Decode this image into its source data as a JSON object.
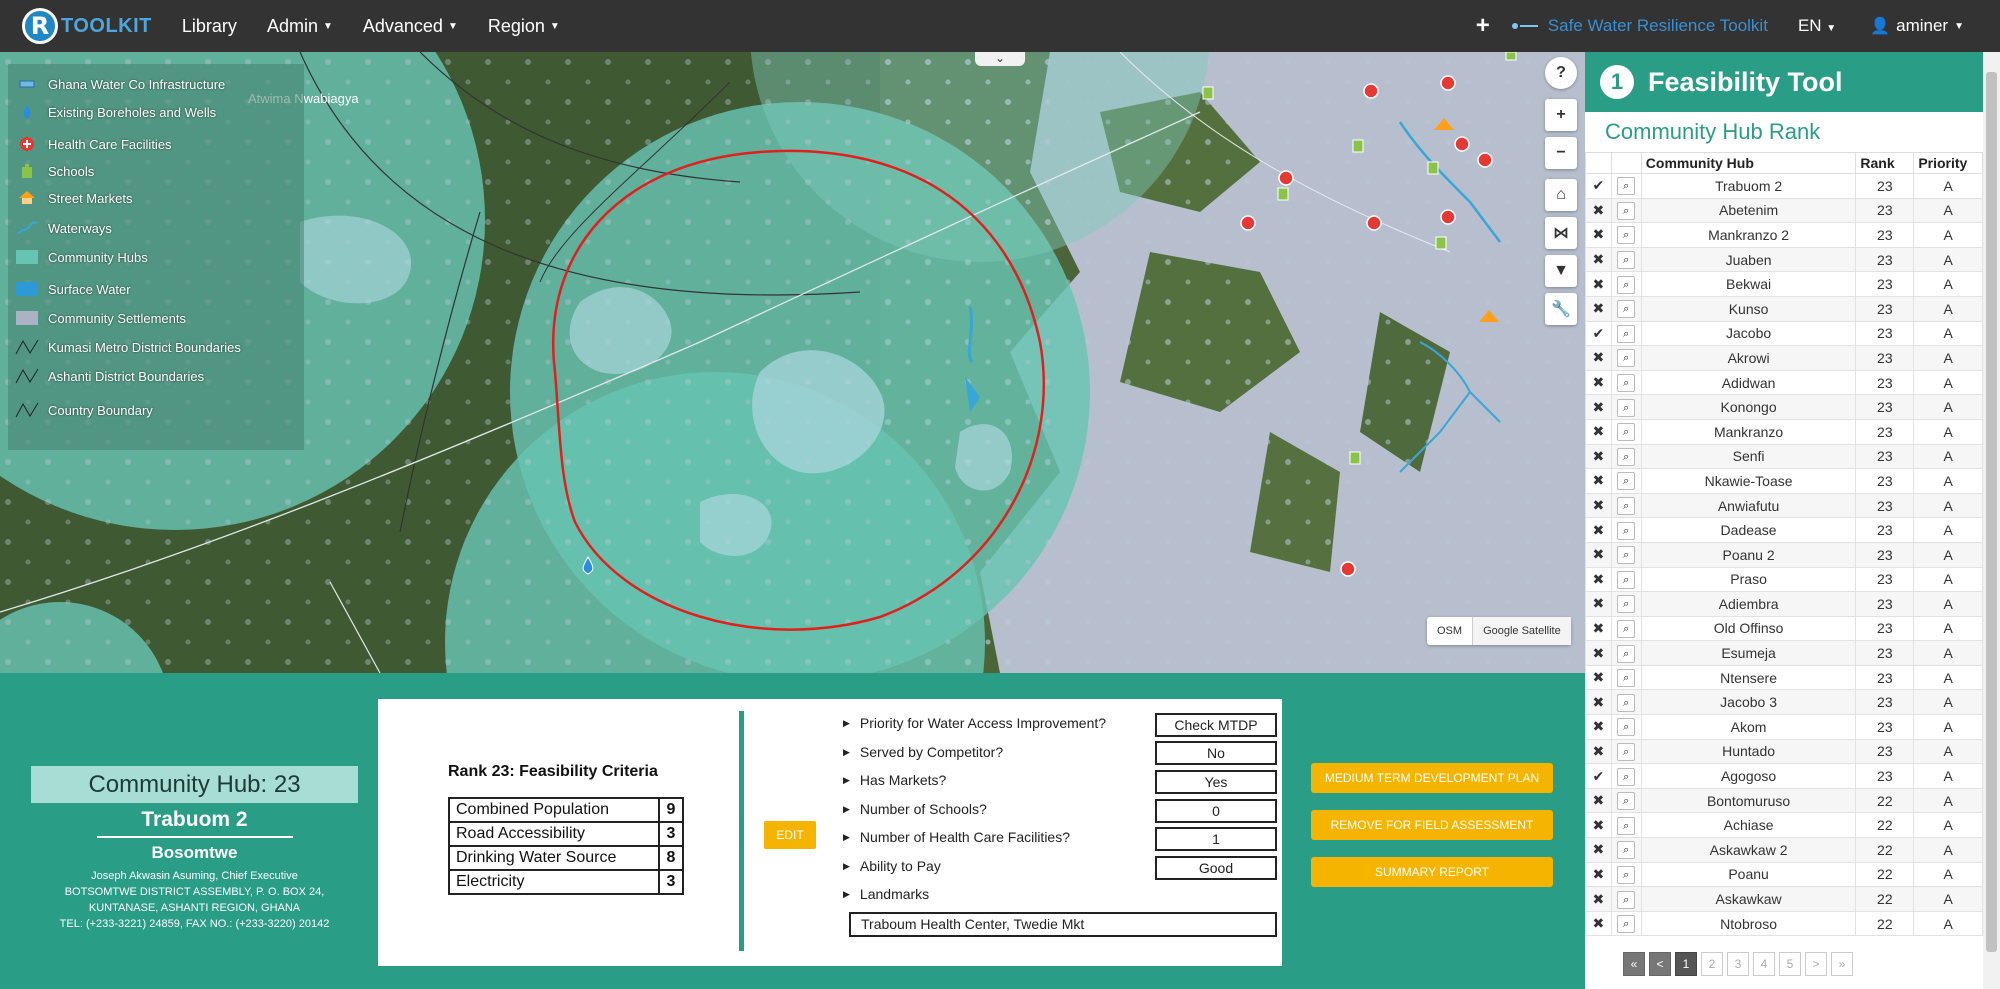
{
  "nav": {
    "brand_letter": "R",
    "brand": "TOOLKIT",
    "items": [
      {
        "label": "Library",
        "dropdown": false
      },
      {
        "label": "Admin",
        "dropdown": true
      },
      {
        "label": "Advanced",
        "dropdown": true
      },
      {
        "label": "Region",
        "dropdown": true
      }
    ],
    "plus": "+",
    "project": "Safe Water Resilience Toolkit",
    "lang": "EN",
    "user": "aminer"
  },
  "map": {
    "place_label": "Atwima Nwabiagya",
    "legend": [
      {
        "label": "Ghana Water Co Infrastructure",
        "icon": "pipe-icon"
      },
      {
        "label": "Existing Boreholes and Wells",
        "icon": "water-drop-icon"
      },
      {
        "label": "Health Care Facilities",
        "icon": "health-cross-icon"
      },
      {
        "label": "Schools",
        "icon": "school-icon"
      },
      {
        "label": "Street Markets",
        "icon": "market-icon"
      },
      {
        "label": "Waterways",
        "icon": "waterway-icon"
      },
      {
        "label": "Community Hubs",
        "icon": "hub-swatch-icon"
      },
      {
        "label": "Surface Water",
        "icon": "surface-water-icon"
      },
      {
        "label": "Community Settlements",
        "icon": "settlement-icon"
      },
      {
        "label": "Kumasi Metro District Boundaries",
        "icon": "boundary-line-icon"
      },
      {
        "label": "Ashanti District Boundaries",
        "icon": "boundary-line-icon"
      },
      {
        "label": "Country Boundary",
        "icon": "boundary-line-icon"
      }
    ],
    "tools": [
      "help-icon",
      "zoom-in-icon",
      "zoom-out-icon",
      "home-icon",
      "share-icon",
      "filter-icon",
      "wrench-icon"
    ],
    "tool_glyphs": [
      "?",
      "+",
      "−",
      "⌂",
      "⋈",
      "▼",
      "🔧"
    ],
    "basemaps": [
      "OSM",
      "Google Satellite"
    ]
  },
  "hub": {
    "title": "Community Hub: 23",
    "name": "Trabuom 2",
    "district": "Bosomtwe",
    "contact_line1": "Joseph Akwasin Asuming, Chief Executive",
    "contact_line2": "BOTSOMTWE DISTRICT ASSEMBLY, P. O. BOX 24,",
    "contact_line3": "KUNTANASE, ASHANTI REGION, GHANA",
    "contact_line4": "TEL: (+233-3221) 24859, FAX NO.: (+233-3220) 20142"
  },
  "criteria": {
    "title": "Rank 23: Feasibility Criteria",
    "rows": [
      {
        "label": "Combined Population",
        "value": "9"
      },
      {
        "label": "Road Accessibility",
        "value": "3"
      },
      {
        "label": "Drinking Water Source",
        "value": "8"
      },
      {
        "label": "Electricity",
        "value": "3"
      }
    ],
    "edit_label": "EDIT"
  },
  "questions": [
    {
      "label": "Priority for Water Access Improvement?",
      "value": "Check MTDP"
    },
    {
      "label": "Served by Competitor?",
      "value": "No"
    },
    {
      "label": "Has Markets?",
      "value": "Yes"
    },
    {
      "label": "Number of Schools?",
      "value": "0"
    },
    {
      "label": "Number of Health Care Facilities?",
      "value": "1"
    },
    {
      "label": "Ability to Pay",
      "value": "Good"
    },
    {
      "label": "Landmarks",
      "value": ""
    }
  ],
  "landmarks_value": "Traboum Health Center, Twedie Mkt",
  "actions": {
    "mtdp": "MEDIUM TERM DEVELOPMENT PLAN",
    "remove": "REMOVE FOR FIELD ASSESSMENT",
    "summary": "SUMMARY REPORT"
  },
  "panel": {
    "step": "1",
    "title": "Feasibility Tool",
    "subtitle": "Community Hub Rank",
    "columns": [
      "Community Hub",
      "Rank",
      "Priority"
    ],
    "rows": [
      {
        "ok": true,
        "name": "Trabuom 2",
        "rank": "23",
        "priority": "A"
      },
      {
        "ok": false,
        "name": "Abetenim",
        "rank": "23",
        "priority": "A"
      },
      {
        "ok": false,
        "name": "Mankranzo 2",
        "rank": "23",
        "priority": "A"
      },
      {
        "ok": false,
        "name": "Juaben",
        "rank": "23",
        "priority": "A"
      },
      {
        "ok": false,
        "name": "Bekwai",
        "rank": "23",
        "priority": "A"
      },
      {
        "ok": false,
        "name": "Kunso",
        "rank": "23",
        "priority": "A"
      },
      {
        "ok": true,
        "name": "Jacobo",
        "rank": "23",
        "priority": "A"
      },
      {
        "ok": false,
        "name": "Akrowi",
        "rank": "23",
        "priority": "A"
      },
      {
        "ok": false,
        "name": "Adidwan",
        "rank": "23",
        "priority": "A"
      },
      {
        "ok": false,
        "name": "Konongo",
        "rank": "23",
        "priority": "A"
      },
      {
        "ok": false,
        "name": "Mankranzo",
        "rank": "23",
        "priority": "A"
      },
      {
        "ok": false,
        "name": "Senfi",
        "rank": "23",
        "priority": "A"
      },
      {
        "ok": false,
        "name": "Nkawie-Toase",
        "rank": "23",
        "priority": "A"
      },
      {
        "ok": false,
        "name": "Anwiafutu",
        "rank": "23",
        "priority": "A"
      },
      {
        "ok": false,
        "name": "Dadease",
        "rank": "23",
        "priority": "A"
      },
      {
        "ok": false,
        "name": "Poanu 2",
        "rank": "23",
        "priority": "A"
      },
      {
        "ok": false,
        "name": "Praso",
        "rank": "23",
        "priority": "A"
      },
      {
        "ok": false,
        "name": "Adiembra",
        "rank": "23",
        "priority": "A"
      },
      {
        "ok": false,
        "name": "Old Offinso",
        "rank": "23",
        "priority": "A"
      },
      {
        "ok": false,
        "name": "Esumeja",
        "rank": "23",
        "priority": "A"
      },
      {
        "ok": false,
        "name": "Ntensere",
        "rank": "23",
        "priority": "A"
      },
      {
        "ok": false,
        "name": "Jacobo 3",
        "rank": "23",
        "priority": "A"
      },
      {
        "ok": false,
        "name": "Akom",
        "rank": "23",
        "priority": "A"
      },
      {
        "ok": false,
        "name": "Huntado",
        "rank": "23",
        "priority": "A"
      },
      {
        "ok": true,
        "name": "Agogoso",
        "rank": "23",
        "priority": "A"
      },
      {
        "ok": false,
        "name": "Bontomuruso",
        "rank": "22",
        "priority": "A"
      },
      {
        "ok": false,
        "name": "Achiase",
        "rank": "22",
        "priority": "A"
      },
      {
        "ok": false,
        "name": "Askawkaw 2",
        "rank": "22",
        "priority": "A"
      },
      {
        "ok": false,
        "name": "Poanu",
        "rank": "22",
        "priority": "A"
      },
      {
        "ok": false,
        "name": "Askawkaw",
        "rank": "22",
        "priority": "A"
      },
      {
        "ok": false,
        "name": "Ntobroso",
        "rank": "22",
        "priority": "A"
      }
    ],
    "pager": [
      "«",
      "<",
      "1",
      "2",
      "3",
      "4",
      "5",
      ">",
      "»"
    ],
    "pager_active": "1"
  },
  "colors": {
    "teal": "#2a9d86",
    "accent_yellow": "#f5b400",
    "nav_bg": "#333333",
    "selection_circle": "#e0201c"
  }
}
